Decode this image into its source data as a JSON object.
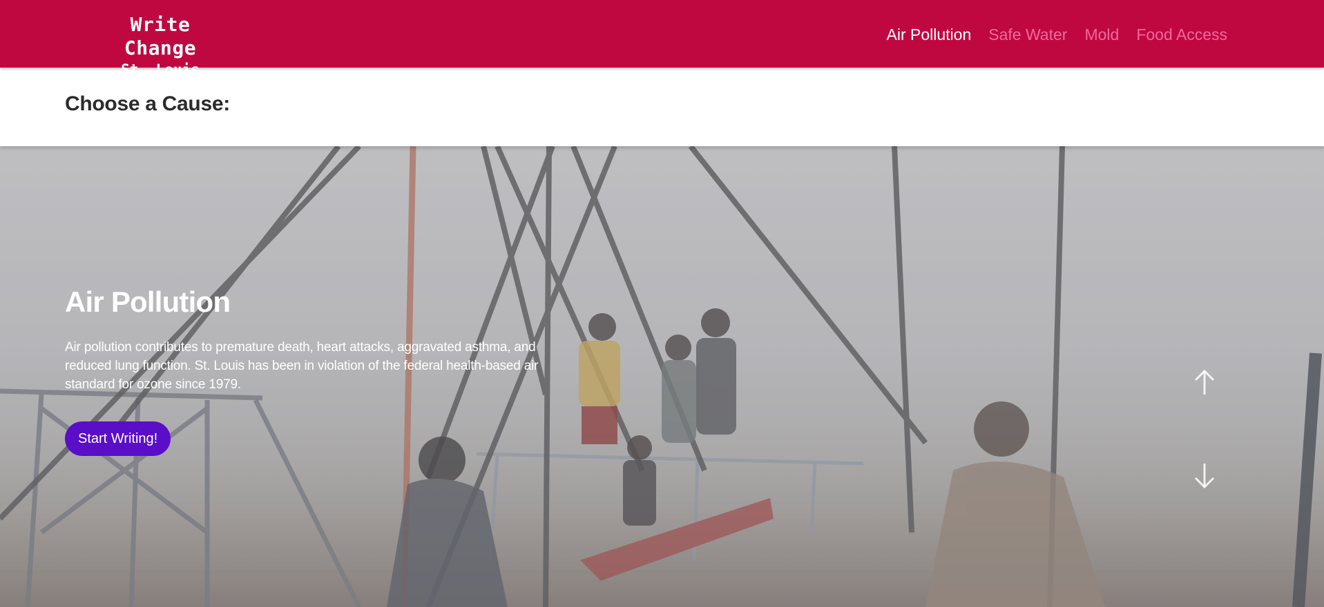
{
  "brand": {
    "title": "Write Change",
    "subtitle": "St. Louis"
  },
  "nav": {
    "items": [
      {
        "label": "Air Pollution",
        "active": true
      },
      {
        "label": "Safe Water",
        "active": false
      },
      {
        "label": "Mold",
        "active": false
      },
      {
        "label": "Food Access",
        "active": false
      }
    ]
  },
  "cause_section": {
    "heading": "Choose a Cause:"
  },
  "hero": {
    "title": "Air Pollution",
    "description": "Air pollution contributes to premature death, heart attacks, aggravated asthma, and reduced lung function. St. Louis has been in violation of the federal health-based air standard for ozone since 1979.",
    "cta_label": "Start Writing!",
    "background_image": "children-on-swings-in-smog",
    "icons": {
      "previous": "arrow-up-icon",
      "next": "arrow-down-icon"
    }
  },
  "colors": {
    "header_bg": "#c00840",
    "nav_inactive": "#f06a9a",
    "nav_active": "#ffffff",
    "cta_bg": "#5a0ec8",
    "heading_text": "#2b2b2b"
  }
}
